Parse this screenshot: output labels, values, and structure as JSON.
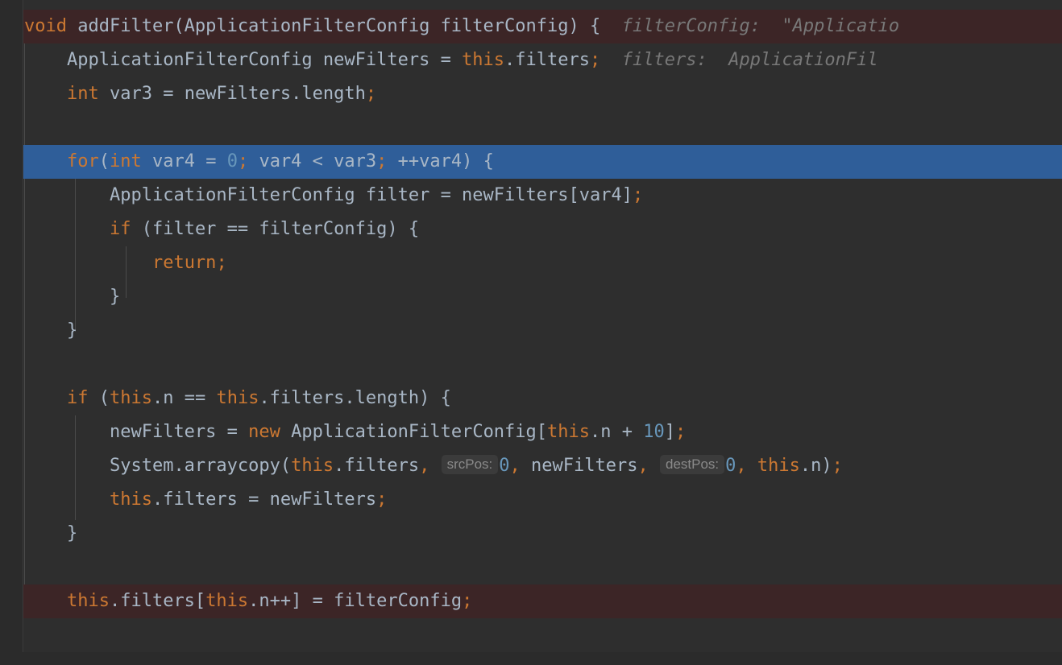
{
  "editor": {
    "language": "java",
    "colors": {
      "background": "#2e2e2e",
      "gutter": "#2b2b2b",
      "keyword": "#cc7832",
      "identifier": "#a9b7c6",
      "number": "#6897bb",
      "hint": "#787878",
      "selection_line": "#2f5e99",
      "execution_line": "#3c2526",
      "indent_guide": "#4b4b4b",
      "caret": "#bbbbbb"
    }
  },
  "code": {
    "line1": {
      "kw_void": "void",
      "signature": " addFilter(ApplicationFilterConfig filterConfig) {",
      "hint": "filterConfig:  \"Applicatio"
    },
    "line2": {
      "decl": "ApplicationFilterConfig newFilters = ",
      "kw_this": "this",
      "tail": ".filters",
      "semi": ";",
      "hint": "filters:  ApplicationFil"
    },
    "line3": {
      "kw_int": "int",
      "rest": " var3 = newFilters.length",
      "semi": ";"
    },
    "line5": {
      "kw_for": "for",
      "paren_open": "(",
      "kw_int": "int",
      "var_init": " var4 = ",
      "zero": "0",
      "semi1": ";",
      "cond": " var4 < var3",
      "semi2": ";",
      "incr": " ++var4) {"
    },
    "line6": {
      "text": "ApplicationFilterConfig filter = newFilters[var4]",
      "semi": ";"
    },
    "line7": {
      "kw_if": "if",
      "rest": " (filter == filterConfig) {"
    },
    "line8": {
      "kw_return": "return",
      "semi": ";"
    },
    "line9": {
      "brace": "}"
    },
    "line10": {
      "brace": "}"
    },
    "line12": {
      "kw_if": "if",
      "open": " (",
      "kw_this1": "this",
      "mid": ".n == ",
      "kw_this2": "this",
      "tail": ".filters.length) {"
    },
    "line13": {
      "assign": "newFilters = ",
      "kw_new": "new",
      "type": " ApplicationFilterConfig[",
      "kw_this": "this",
      "plus": ".n + ",
      "ten": "10",
      "close": "]",
      "semi": ";"
    },
    "line14": {
      "call": "System.arraycopy(",
      "kw_this1": "this",
      "arg1": ".filters",
      "comma1": ",",
      "chip_srcpos": "srcPos:",
      "zero1": "0",
      "comma2": ",",
      "arg2": " newFilters",
      "comma3": ",",
      "chip_destpos": "destPos:",
      "zero2": "0",
      "comma4": ",",
      "kw_this2": " this",
      "tail": ".n)",
      "semi": ";"
    },
    "line15": {
      "kw_this": "this",
      "rest": ".filters = newFilters",
      "semi": ";"
    },
    "line16": {
      "brace": "}"
    },
    "line18": {
      "kw_this1": "this",
      "mid": ".filters[",
      "kw_this2": "this",
      "mid2": ".n++] = filterConfig",
      "semi": ";"
    },
    "line19": {
      "brace": "}"
    }
  }
}
